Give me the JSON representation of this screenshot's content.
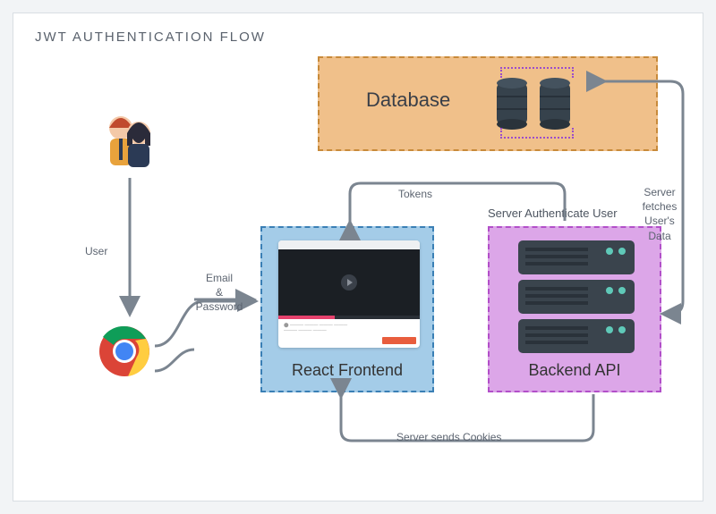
{
  "title": "JWT AUTHENTICATION FLOW",
  "nodes": {
    "database": {
      "label": "Database"
    },
    "frontend": {
      "label": "React Frontend"
    },
    "backend": {
      "label": "Backend API",
      "heading": "Server Authenticate User"
    },
    "user": {},
    "browser": {}
  },
  "edges": {
    "user_to_browser": {
      "label": "User"
    },
    "browser_to_frontend": {
      "label": "Email\n&\nPassword"
    },
    "frontend_to_backend_tokens": {
      "label": "Tokens"
    },
    "backend_to_frontend_cookies": {
      "label": "Server sends Cookies"
    },
    "backend_to_database": {
      "label": "Server\nfetches\nUser's\nData"
    }
  },
  "colors": {
    "database_fill": "#f0c08a",
    "database_border": "#c88a3a",
    "frontend_fill": "#a4cce8",
    "frontend_border": "#3a7fb5",
    "backend_fill": "#dca6e8",
    "backend_border": "#b24fc9",
    "arrow": "#7b8590"
  }
}
